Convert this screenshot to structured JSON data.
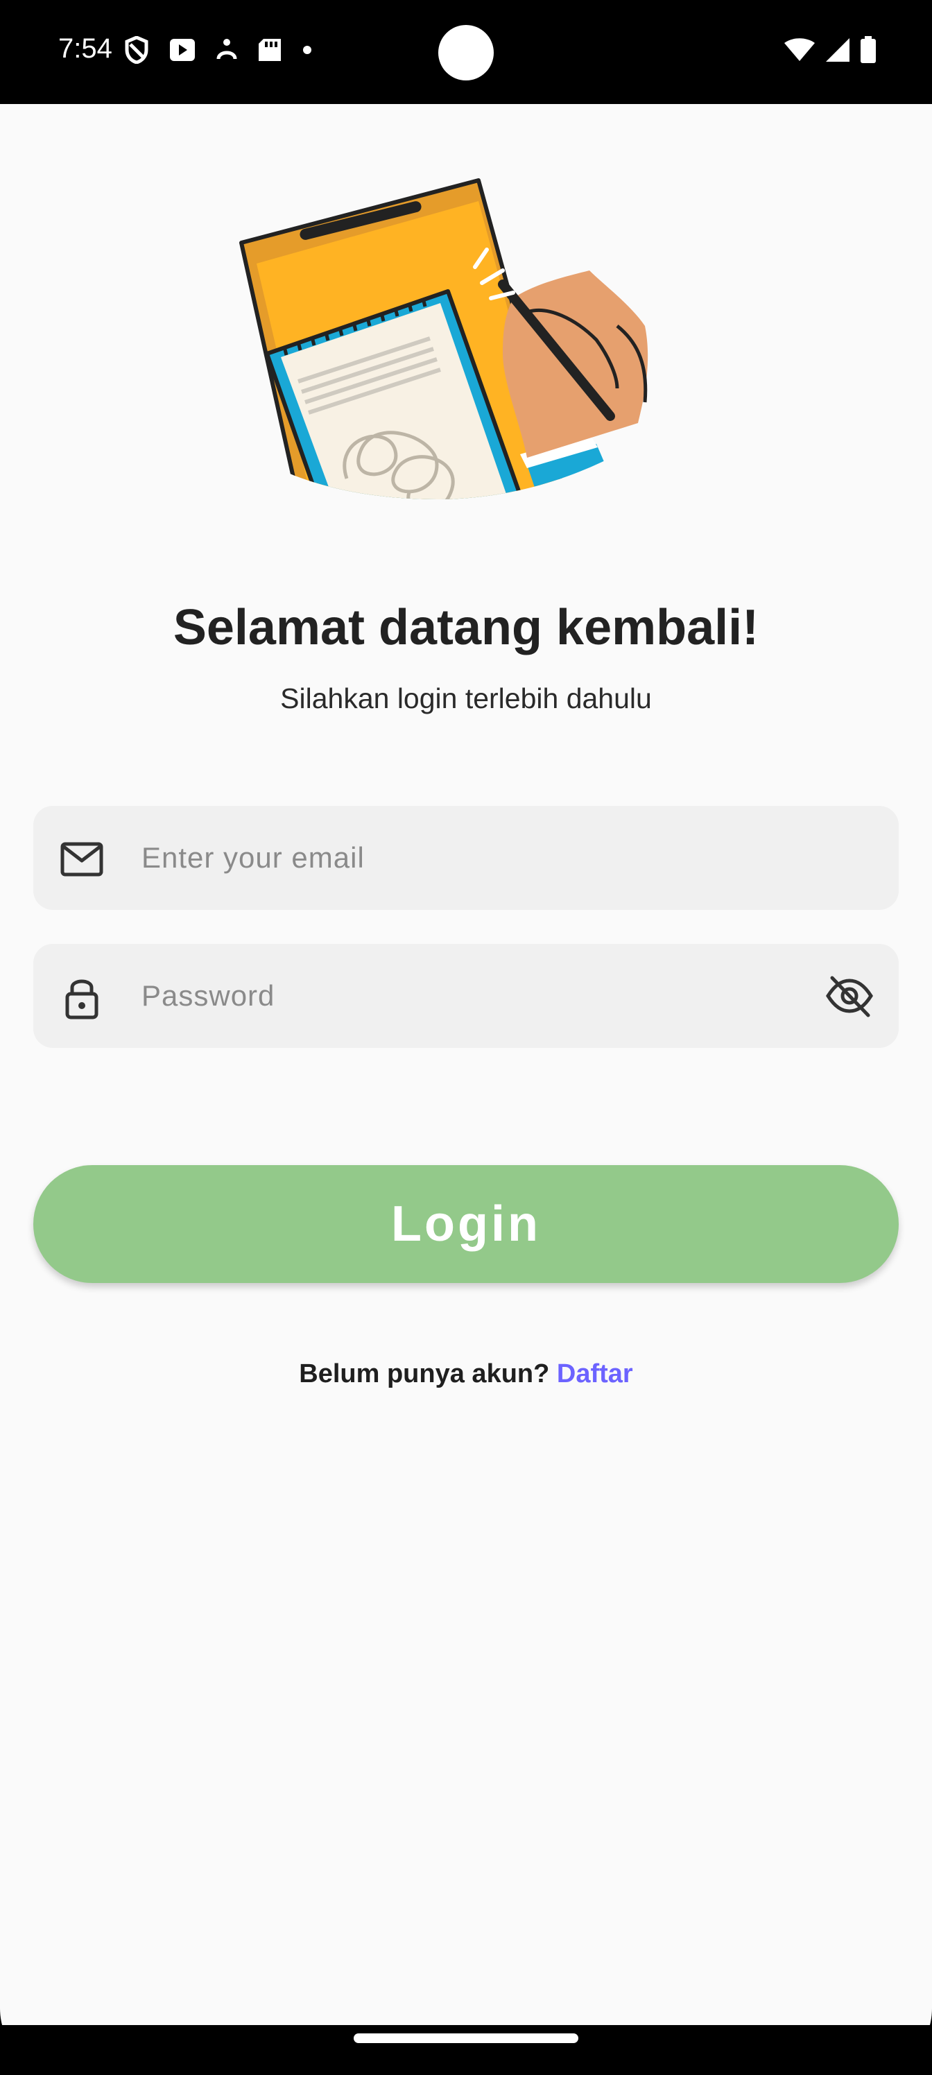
{
  "status_bar": {
    "time": "7:54",
    "left_icons": [
      "shield-icon",
      "play-store-icon",
      "accessibility-icon",
      "sd-card-icon",
      "dot-icon"
    ],
    "right_icons": [
      "wifi-icon",
      "cellular-signal-icon",
      "battery-icon"
    ]
  },
  "login": {
    "title": "Selamat datang kembali!",
    "subtitle": "Silahkan login terlebih dahulu",
    "email": {
      "placeholder": "Enter your email",
      "value": "",
      "icon": "mail-icon"
    },
    "password": {
      "placeholder": "Password",
      "value": "",
      "icon": "lock-icon",
      "toggle_icon": "eye-off-icon"
    },
    "button_label": "Login",
    "signup_prompt": "Belum punya akun?",
    "signup_link": "Daftar"
  },
  "colors": {
    "button": "#93c98a",
    "link": "#6c63ff",
    "field_bg": "#f0f0f0",
    "background": "#fafafa"
  }
}
